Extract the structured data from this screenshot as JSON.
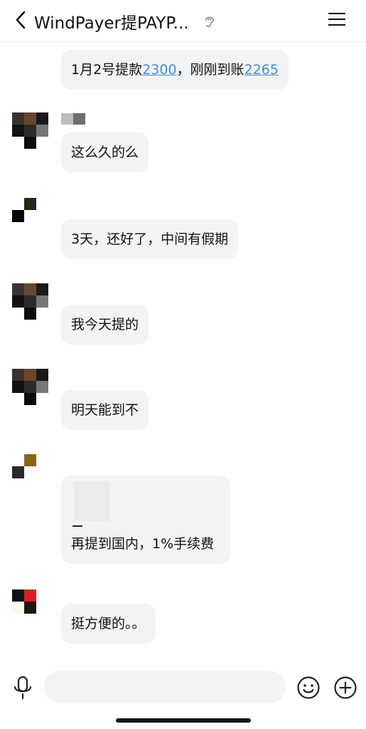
{
  "header": {
    "title": "WindPayer提PAYP...",
    "back_icon": "chevron-left-icon",
    "ear_icon": "ear-icon",
    "menu_icon": "hamburger-menu-icon"
  },
  "messages": [
    {
      "parts": [
        "1月2号提款",
        "2300",
        "，刚刚到账",
        "2265"
      ]
    },
    {
      "text": "这么久的么"
    },
    {
      "text": "3天，还好了，中间有假期"
    },
    {
      "text": "我今天提的"
    },
    {
      "text": "明天能到不"
    },
    {
      "text": "再提到国内，1%手续费"
    },
    {
      "text": "挺方便的。。"
    }
  ],
  "input_bar": {
    "mic_icon": "microphone-icon",
    "emoji_icon": "emoji-icon",
    "plus_icon": "plus-circle-icon",
    "input_value": ""
  },
  "colors": {
    "link": "#3e8fe0",
    "bubble": "#f2f3f5",
    "background": "#ffffff"
  }
}
